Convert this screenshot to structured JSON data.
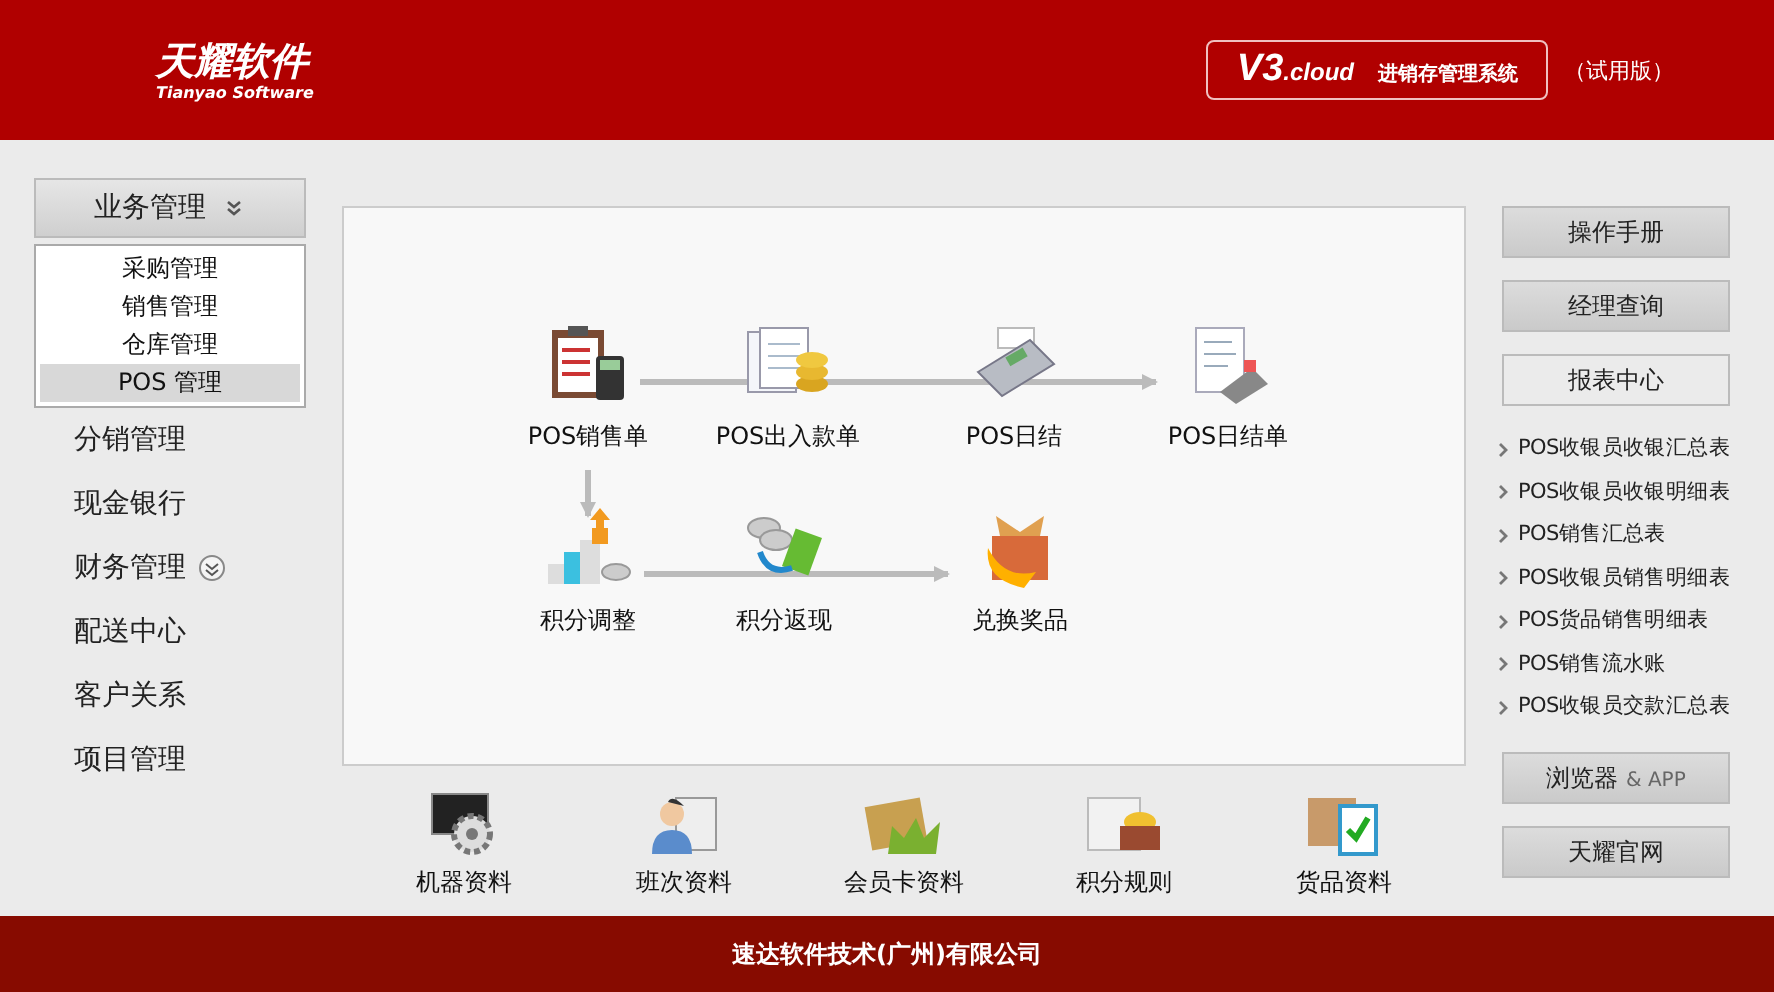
{
  "header": {
    "logo_cn": "天耀软件",
    "logo_en": "Tianyao Software",
    "product_version": "V3",
    "product_suffix": ".cloud",
    "product_name": "进销存管理系统",
    "edition": "（试用版）"
  },
  "sidebar": {
    "items": [
      {
        "label": "业务管理",
        "kind": "group",
        "expanded": true,
        "children": [
          {
            "label": "采购管理",
            "selected": false
          },
          {
            "label": "销售管理",
            "selected": false
          },
          {
            "label": "仓库管理",
            "selected": false
          },
          {
            "label": "POS 管理",
            "selected": true
          }
        ]
      },
      {
        "label": "分销管理",
        "kind": "link"
      },
      {
        "label": "现金银行",
        "kind": "link"
      },
      {
        "label": "财务管理",
        "kind": "group",
        "expanded": false
      },
      {
        "label": "配送中心",
        "kind": "link"
      },
      {
        "label": "客户关系",
        "kind": "link"
      },
      {
        "label": "项目管理",
        "kind": "link"
      }
    ]
  },
  "flow": {
    "nodes": [
      {
        "label": "POS销售单"
      },
      {
        "label": "POS出入款单"
      },
      {
        "label": "POS日结"
      },
      {
        "label": "POS日结单"
      },
      {
        "label": "积分调整"
      },
      {
        "label": "积分返现"
      },
      {
        "label": "兑换奖品"
      }
    ]
  },
  "shortcuts": [
    {
      "label": "机器资料"
    },
    {
      "label": "班次资料"
    },
    {
      "label": "会员卡资料"
    },
    {
      "label": "积分规则"
    },
    {
      "label": "货品资料"
    }
  ],
  "right_panel": {
    "top_buttons": [
      "操作手册",
      "经理查询",
      "报表中心"
    ],
    "reports": [
      "POS收银员收银汇总表",
      "POS收银员收银明细表",
      "POS销售汇总表",
      "POS收银员销售明细表",
      "POS货品销售明细表",
      "POS销售流水账",
      "POS收银员交款汇总表"
    ],
    "bottom_buttons": [
      {
        "text": "浏览器",
        "suffix": "& APP"
      },
      {
        "text": "天耀官网"
      }
    ]
  },
  "footer": {
    "text": "速达软件技术(广州)有限公司"
  }
}
